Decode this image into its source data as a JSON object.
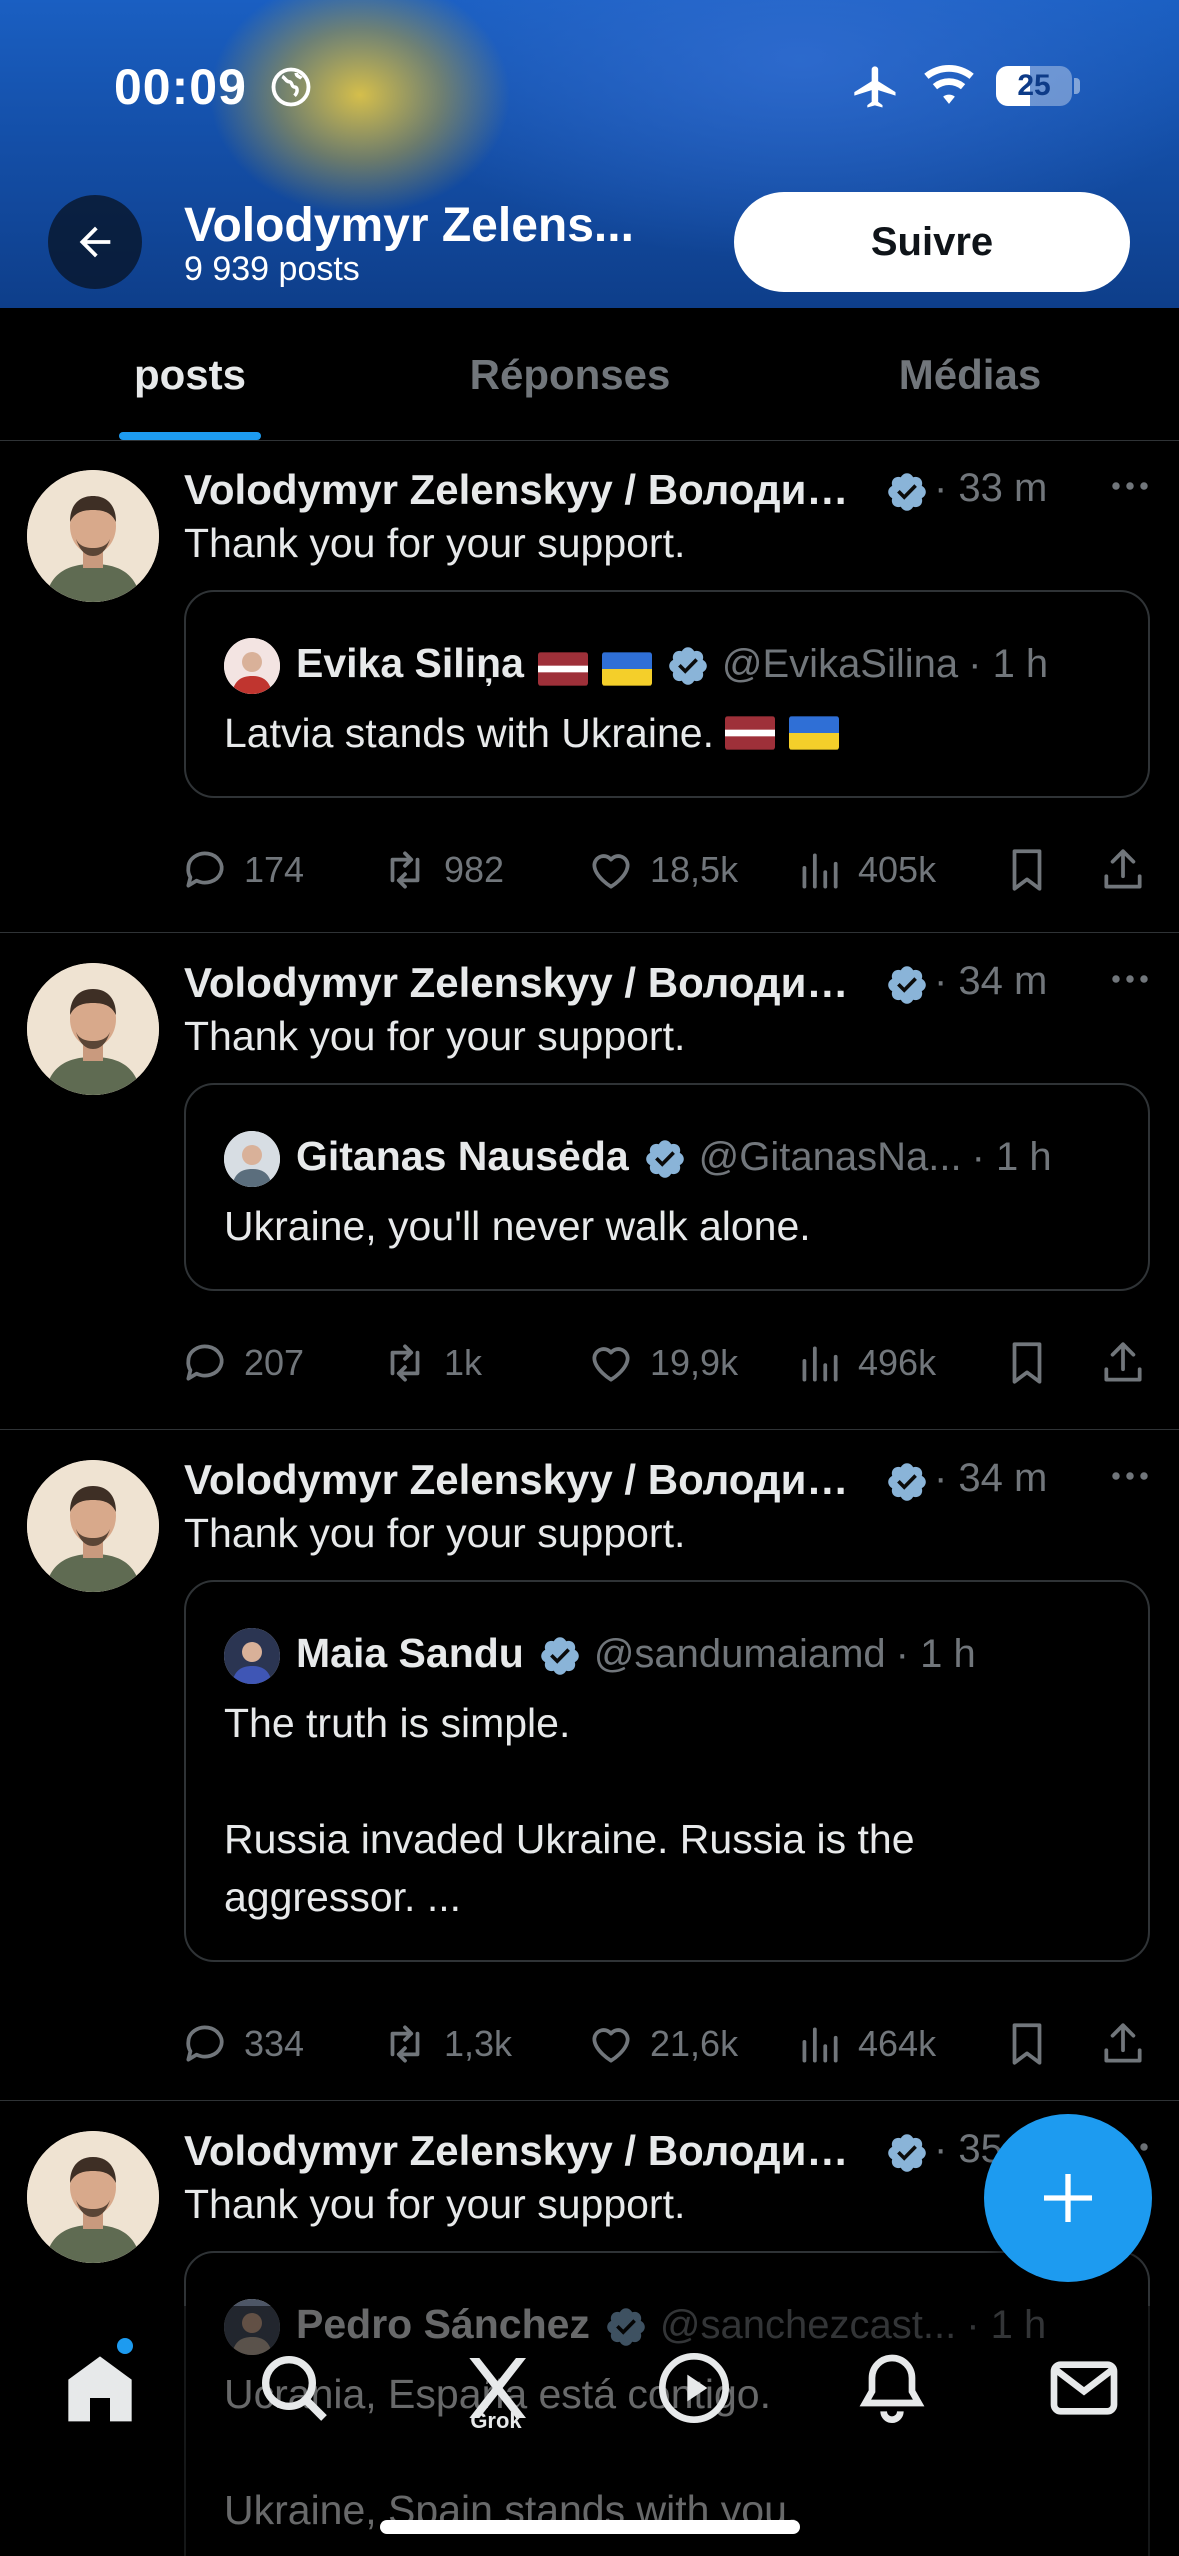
{
  "status_bar": {
    "time": "00:09",
    "battery_level": "25",
    "battery_fraction": 0.25
  },
  "header": {
    "name": "Volodymyr Zelens...",
    "post_count": "9 939 posts",
    "follow_label": "Suivre"
  },
  "tabs": [
    {
      "label": "posts",
      "active": true
    },
    {
      "label": "Réponses",
      "active": false
    },
    {
      "label": "Médias",
      "active": false
    }
  ],
  "colors": {
    "accent": "#1d9bf0",
    "background": "#000000",
    "text_primary": "#e7e9ea",
    "text_secondary": "#71767b",
    "border": "#2f3336"
  },
  "posts": [
    {
      "author": "Volodymyr Zelenskyy / Володимир Зеленський",
      "time": "· 33 m",
      "text": "Thank you for your support.",
      "quote": {
        "name": "Evika Siliņa",
        "flags": [
          "latvia-flag",
          "ukraine-flag"
        ],
        "handle": "@EvikaSilina",
        "time": "· 1 h",
        "body": "Latvia stands with Ukraine.",
        "body_flags": [
          "latvia-flag",
          "ukraine-flag"
        ]
      },
      "stats": {
        "replies": "174",
        "reposts": "982",
        "likes": "18,5k",
        "views": "405k"
      }
    },
    {
      "author": "Volodymyr Zelenskyy / Володимир Зеленський",
      "time": "· 34 m",
      "text": "Thank you for your support.",
      "quote": {
        "name": "Gitanas Nausėda",
        "handle": "@GitanasNa...",
        "time": "· 1 h",
        "body": "Ukraine, you'll never walk alone."
      },
      "stats": {
        "replies": "207",
        "reposts": "1k",
        "likes": "19,9k",
        "views": "496k"
      }
    },
    {
      "author": "Volodymyr Zelenskyy / Володимир Зеленський",
      "time": "· 34 m",
      "text": "Thank you for your support.",
      "quote": {
        "name": "Maia Sandu",
        "handle": "@sandumaiamd",
        "time": "· 1 h",
        "body": "The truth is simple.\n\nRussia invaded Ukraine. Russia is the\naggressor. ..."
      },
      "stats": {
        "replies": "334",
        "reposts": "1,3k",
        "likes": "21,6k",
        "views": "464k"
      }
    },
    {
      "author": "Volodymyr Zelenskyy / Володимир Зеленський",
      "time": "· 35 m",
      "text": "Thank you for your support.",
      "quote": {
        "name": "Pedro Sánchez",
        "handle": "@sanchezcast...",
        "time": "· 1 h",
        "body": "Ucrania, España está contigo.\n\nUkraine, Spain stands with you."
      }
    }
  ],
  "bottom_nav": {
    "items": [
      "home-icon",
      "search-icon",
      "grok-icon",
      "video-icon",
      "notifications-icon",
      "messages-icon"
    ],
    "grok_label": "Grok"
  }
}
